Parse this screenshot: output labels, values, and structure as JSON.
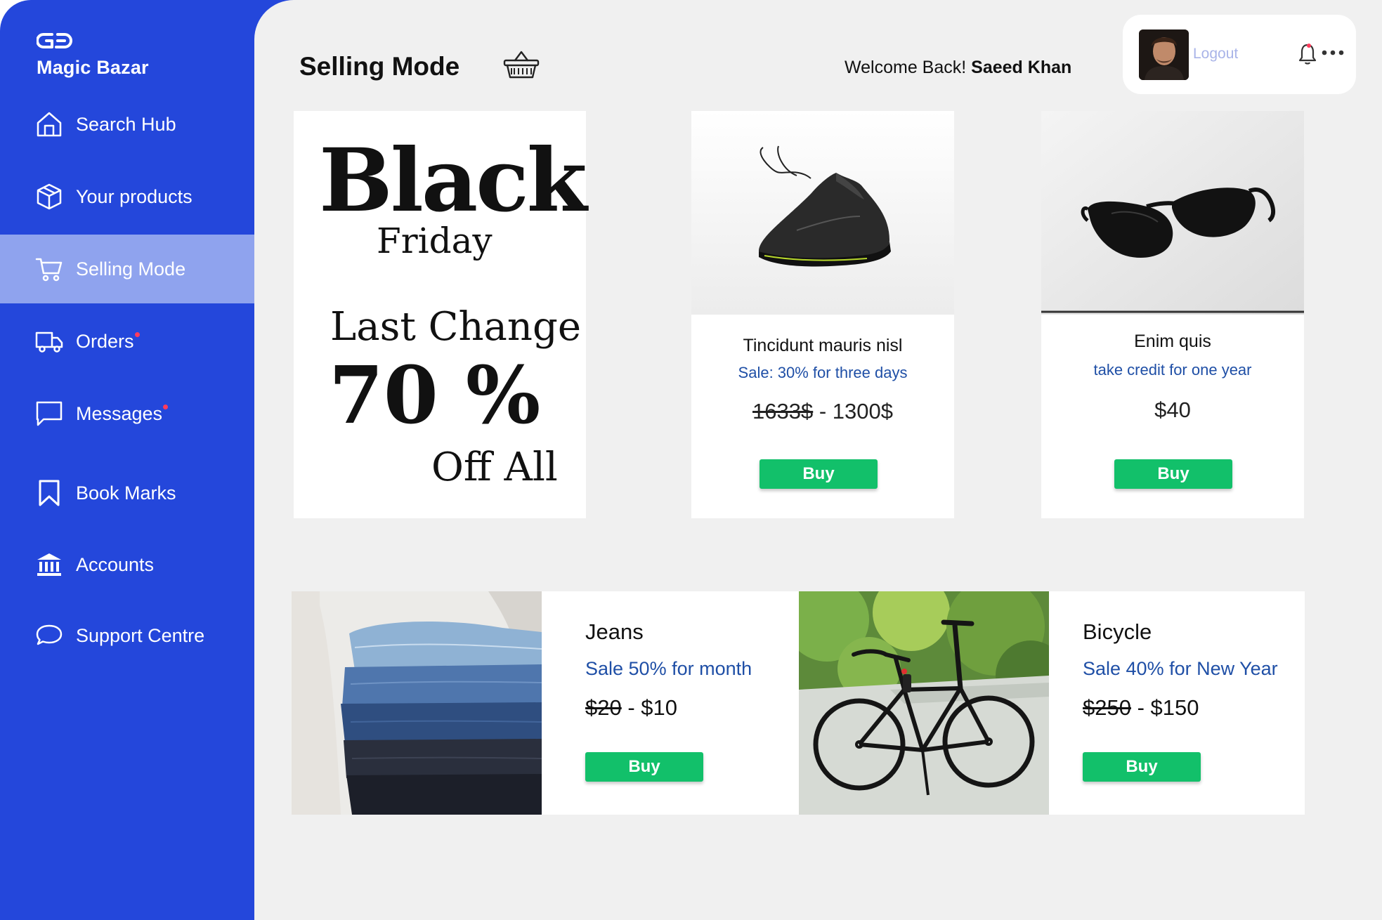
{
  "brand": {
    "name": "Magic Bazar"
  },
  "sidebar": {
    "items": [
      {
        "label": "Search Hub",
        "icon": "home-icon"
      },
      {
        "label": "Your products",
        "icon": "box-icon"
      },
      {
        "label": "Selling Mode",
        "icon": "cart-icon",
        "active": true
      },
      {
        "label": "Orders",
        "icon": "truck-icon",
        "badge_dot": true
      },
      {
        "label": "Messages",
        "icon": "message-icon",
        "badge_dot": true
      },
      {
        "label": "Book Marks",
        "icon": "bookmark-icon"
      },
      {
        "label": "Accounts",
        "icon": "bank-icon"
      },
      {
        "label": "Support Centre",
        "icon": "chat-bubble-icon"
      }
    ]
  },
  "header": {
    "title": "Selling Mode",
    "welcome_prefix": "Welcome Back!",
    "user_name": "Saeed Khan",
    "logout_label": "Logout"
  },
  "promo": {
    "line1": "Black",
    "line2": "Friday",
    "line3": "Last Change",
    "line4": "70 %",
    "line5": "Off All"
  },
  "products": [
    {
      "name": "Tincidunt mauris nisl",
      "sale": "Sale: 30% for three days",
      "old_price": "1633$",
      "separator": " - ",
      "price": "1300$",
      "buy": "Buy",
      "image": "sneaker"
    },
    {
      "name": "Enim quis",
      "sale": "take credit for one year",
      "price": "$40",
      "buy": "Buy",
      "image": "sunglasses"
    }
  ],
  "wide_products": [
    {
      "name": "Jeans",
      "sale": "Sale 50% for month",
      "old_price": "$20",
      "separator": " - ",
      "price": "$10",
      "buy": "Buy",
      "image": "jeans-stack"
    },
    {
      "name": "Bicycle",
      "sale": "Sale 40% for New Year",
      "old_price": "$250",
      "separator": " - ",
      "price": "$150",
      "buy": "Buy",
      "image": "bicycle"
    }
  ],
  "colors": {
    "sidebar": "#2447db",
    "active_item": "#8fa3ee",
    "background": "#f0f0f0",
    "buy_button": "#12c06a",
    "sale_text": "#1f4fa6",
    "notification_dot": "#ff3b5c"
  }
}
